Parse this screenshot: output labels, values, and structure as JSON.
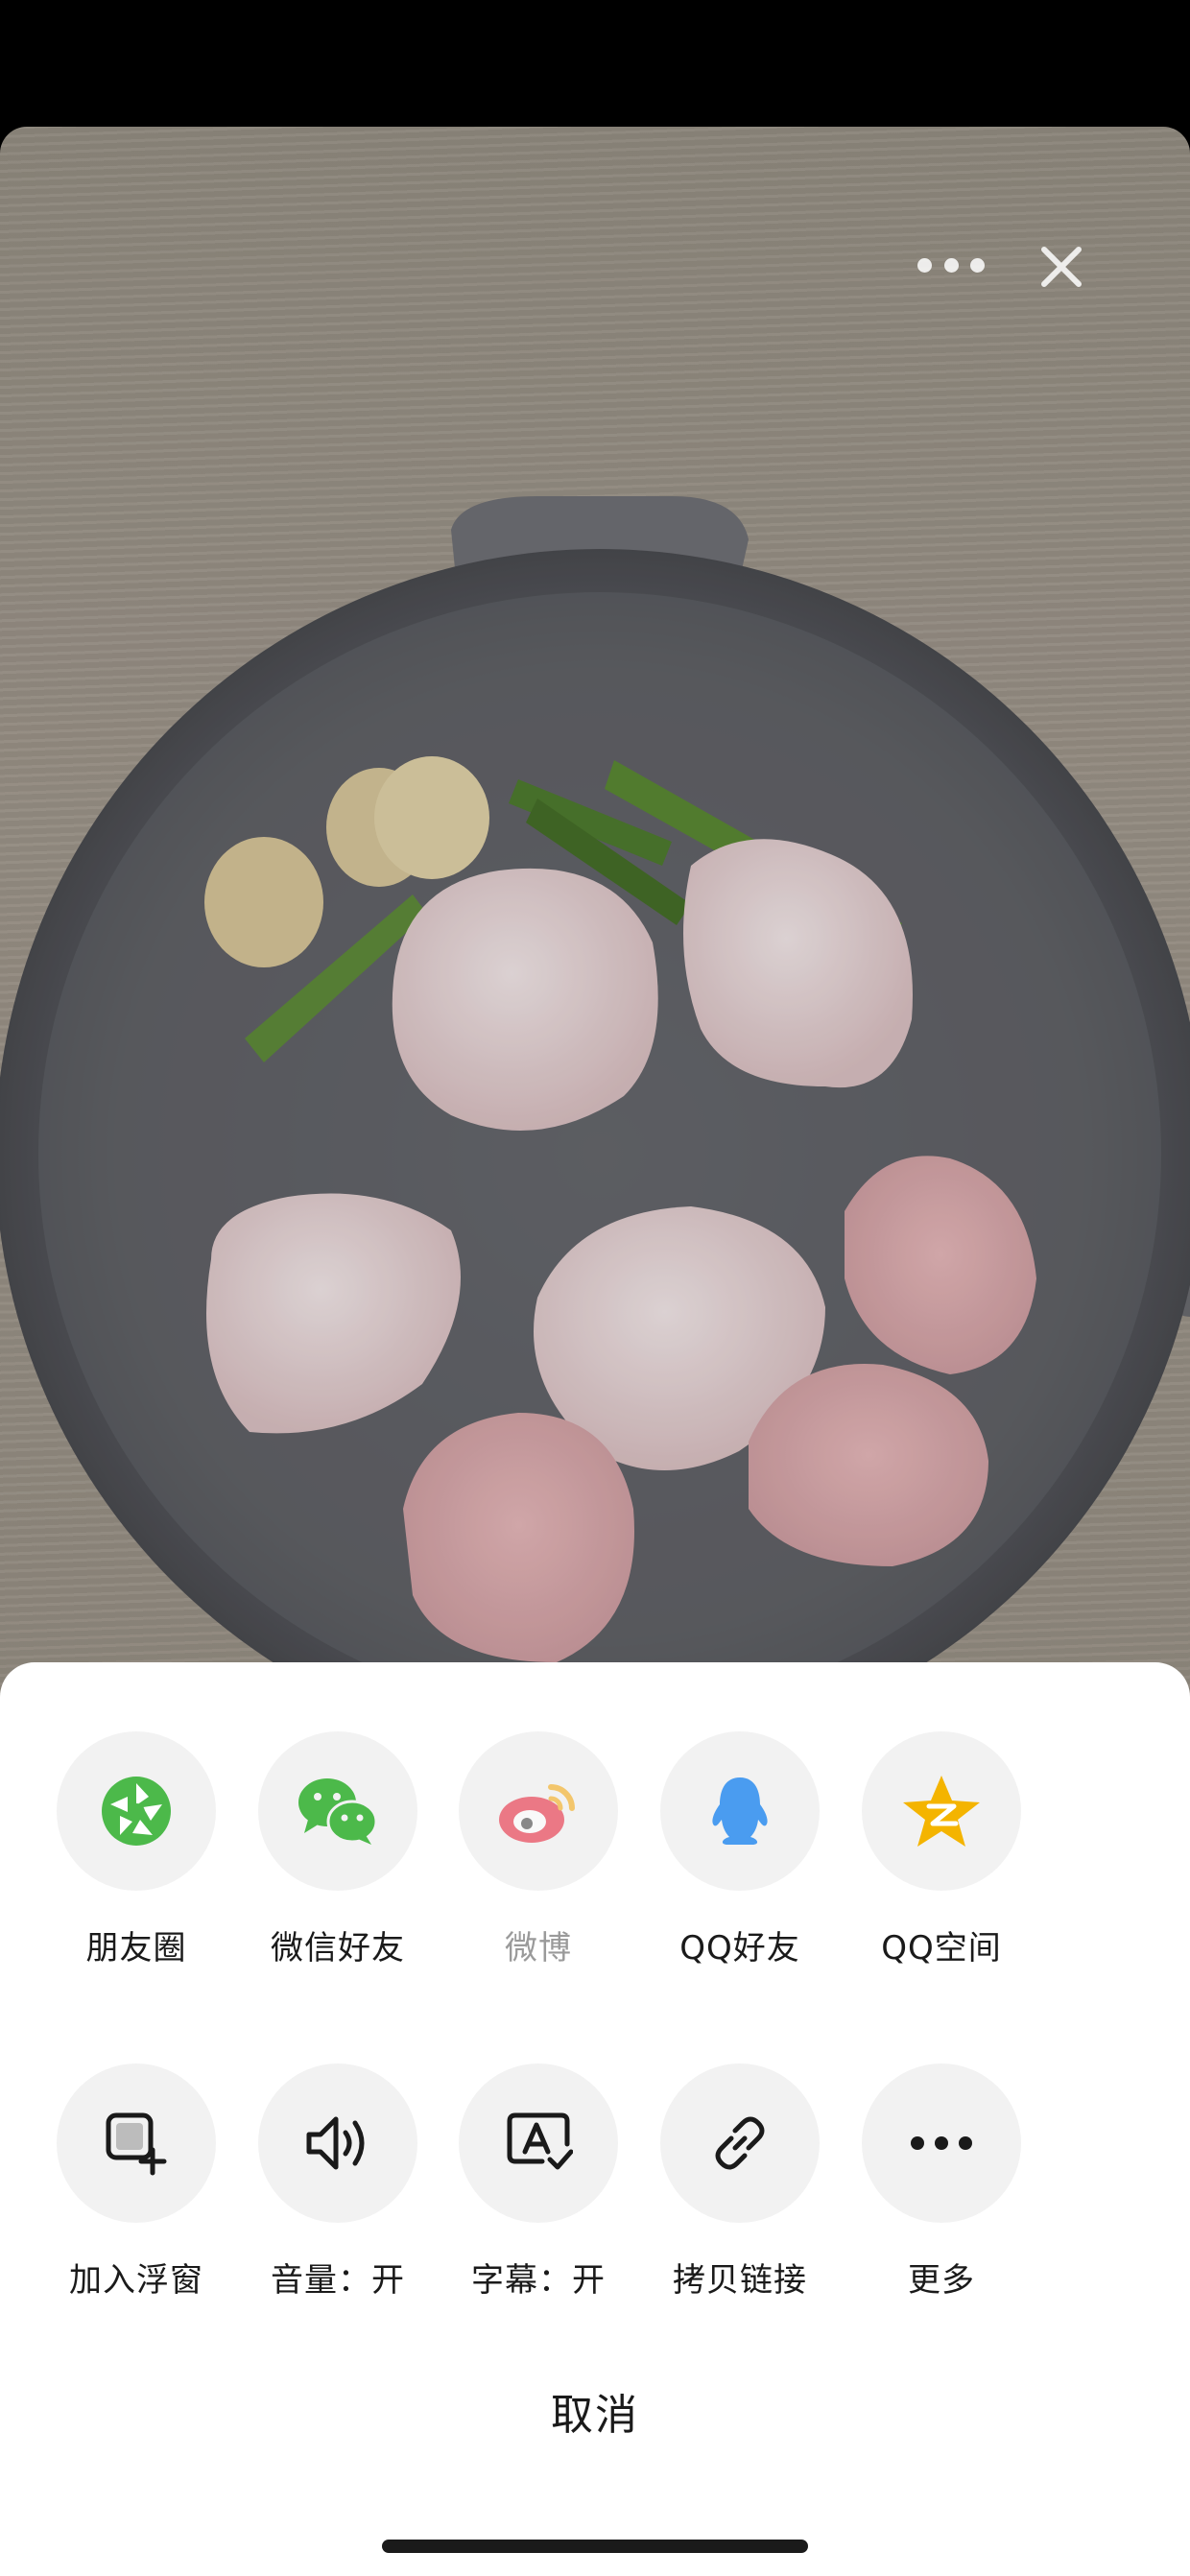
{
  "media": {
    "description_icons": [
      "more-icon",
      "close-icon"
    ]
  },
  "share_row": [
    {
      "label": "朋友圈",
      "icon": "moments-icon",
      "color": "#4cb94a"
    },
    {
      "label": "微信好友",
      "icon": "wechat-icon",
      "color": "#4cb94a"
    },
    {
      "label": "微博",
      "icon": "weibo-icon",
      "color": "#e6162d",
      "disabled": true
    },
    {
      "label": "QQ好友",
      "icon": "qq-icon",
      "color": "#4a9cf0"
    },
    {
      "label": "QQ空间",
      "icon": "qzone-icon",
      "color": "#f4b400"
    }
  ],
  "action_row": [
    {
      "label": "加入浮窗",
      "icon": "floating-window-icon"
    },
    {
      "label": "音量：开",
      "icon": "volume-icon"
    },
    {
      "label": "字幕：开",
      "icon": "subtitle-icon"
    },
    {
      "label": "拷贝链接",
      "icon": "link-icon"
    },
    {
      "label": "更多",
      "icon": "more-icon"
    }
  ],
  "cancel_label": "取消"
}
